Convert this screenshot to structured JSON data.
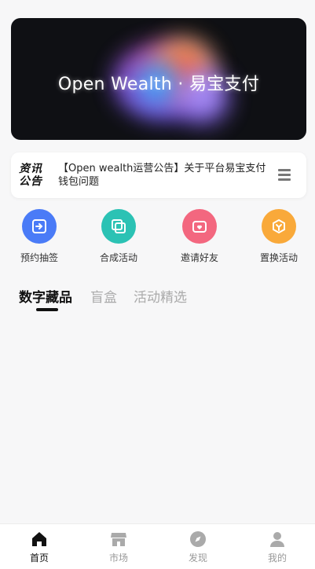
{
  "banner": {
    "text": "Open Wealth · 易宝支付"
  },
  "notice": {
    "logo_line1": "资讯",
    "logo_line2": "公告",
    "text": "【Open wealth运营公告】关于平台易宝支付钱包问题",
    "menu_icon": "menu-icon"
  },
  "actions": [
    {
      "label": "预约抽签",
      "icon": "reserve-icon",
      "color": "#4a7bf7"
    },
    {
      "label": "合成活动",
      "icon": "compose-icon",
      "color": "#2bc2b4"
    },
    {
      "label": "邀请好友",
      "icon": "invite-icon",
      "color": "#f3677f"
    },
    {
      "label": "置换活动",
      "icon": "exchange-icon",
      "color": "#f9a93a"
    }
  ],
  "tabs": [
    {
      "label": "数字藏品",
      "active": true
    },
    {
      "label": "盲盒",
      "active": false
    },
    {
      "label": "活动精选",
      "active": false
    }
  ],
  "bottom_nav": [
    {
      "label": "首页",
      "icon": "home-icon",
      "active": true
    },
    {
      "label": "市场",
      "icon": "store-icon",
      "active": false
    },
    {
      "label": "发现",
      "icon": "compass-icon",
      "active": false
    },
    {
      "label": "我的",
      "icon": "user-icon",
      "active": false
    }
  ]
}
